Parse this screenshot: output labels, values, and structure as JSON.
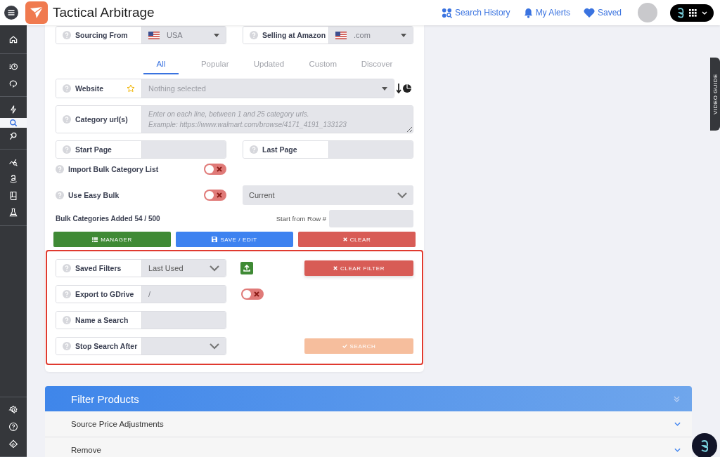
{
  "header": {
    "title": "Tactical Arbitrage",
    "nav": [
      {
        "label": "Search History"
      },
      {
        "label": "My Alerts"
      },
      {
        "label": "Saved"
      }
    ]
  },
  "sidebar": {
    "groups": [
      [
        {
          "selected": false
        }
      ],
      [
        {
          "selected": false
        },
        {
          "selected": false
        }
      ],
      [
        {
          "selected": false
        },
        {
          "selected": true
        },
        {
          "selected": false
        }
      ],
      [
        {
          "selected": false
        },
        {
          "selected": false
        },
        {
          "selected": false
        },
        {
          "selected": false
        }
      ]
    ],
    "bottom": [
      {
        "selected": false
      },
      {
        "selected": false
      },
      {
        "selected": false
      }
    ]
  },
  "form": {
    "sourcing_from": {
      "label": "Sourcing From",
      "value": "USA"
    },
    "selling_at": {
      "label": "Selling at Amazon",
      "value": ".com"
    },
    "tabs": [
      {
        "label": "All",
        "selected": true
      },
      {
        "label": "Popular",
        "selected": false
      },
      {
        "label": "Updated",
        "selected": false
      },
      {
        "label": "Custom",
        "selected": false
      },
      {
        "label": "Discover",
        "selected": false
      }
    ],
    "website": {
      "label": "Website",
      "placeholder": "Nothing selected"
    },
    "category_urls": {
      "label": "Category url(s)",
      "placeholder": "Enter on each line, between 1 and 25 category urls.\nExample: https://www.walmart.com/browse/4171_4191_133123"
    },
    "start_page": {
      "label": "Start Page"
    },
    "last_page": {
      "label": "Last Page"
    },
    "import_bulk": {
      "label": "Import Bulk Category List",
      "on": false
    },
    "easy_bulk": {
      "label": "Use Easy Bulk",
      "on": false,
      "value": "Current"
    },
    "bulk_count": "Bulk Categories Added 54 / 500",
    "start_row": {
      "label": "Start from Row #"
    },
    "buttons": [
      {
        "label": "MANAGER",
        "kind": "success"
      },
      {
        "label": "SAVE / EDIT",
        "kind": "primary"
      },
      {
        "label": "CLEAR",
        "kind": "danger"
      }
    ],
    "saved_filters": {
      "label": "Saved Filters",
      "value": "Last Used"
    },
    "clear_filter": {
      "label": "CLEAR FILTER"
    },
    "export_gdrive": {
      "label": "Export to GDrive",
      "value": "/",
      "on": false
    },
    "name_search": {
      "label": "Name a Search"
    },
    "stop_search": {
      "label": "Stop Search After"
    },
    "search": {
      "label": "SEARCH",
      "disabled": true
    }
  },
  "accordion": {
    "title": "Filter Products",
    "items": [
      "Source Price Adjustments",
      "Remove"
    ]
  },
  "video_guide": "VIDEO GUIDE"
}
